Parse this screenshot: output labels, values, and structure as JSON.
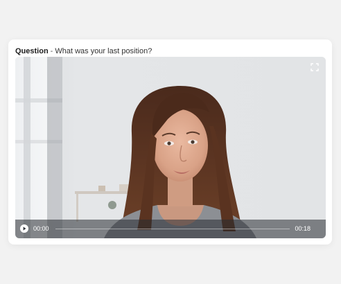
{
  "question": {
    "label": "Question",
    "separator": "-",
    "text": "What was your last position?"
  },
  "video": {
    "current_time": "00:00",
    "total_time": "00:18",
    "progress": 0,
    "play_icon": "play-icon",
    "fullscreen_icon": "fullscreen-icon"
  },
  "colors": {
    "background": "#f2f2f2",
    "card": "#ffffff",
    "controls_bar": "#282c32"
  }
}
